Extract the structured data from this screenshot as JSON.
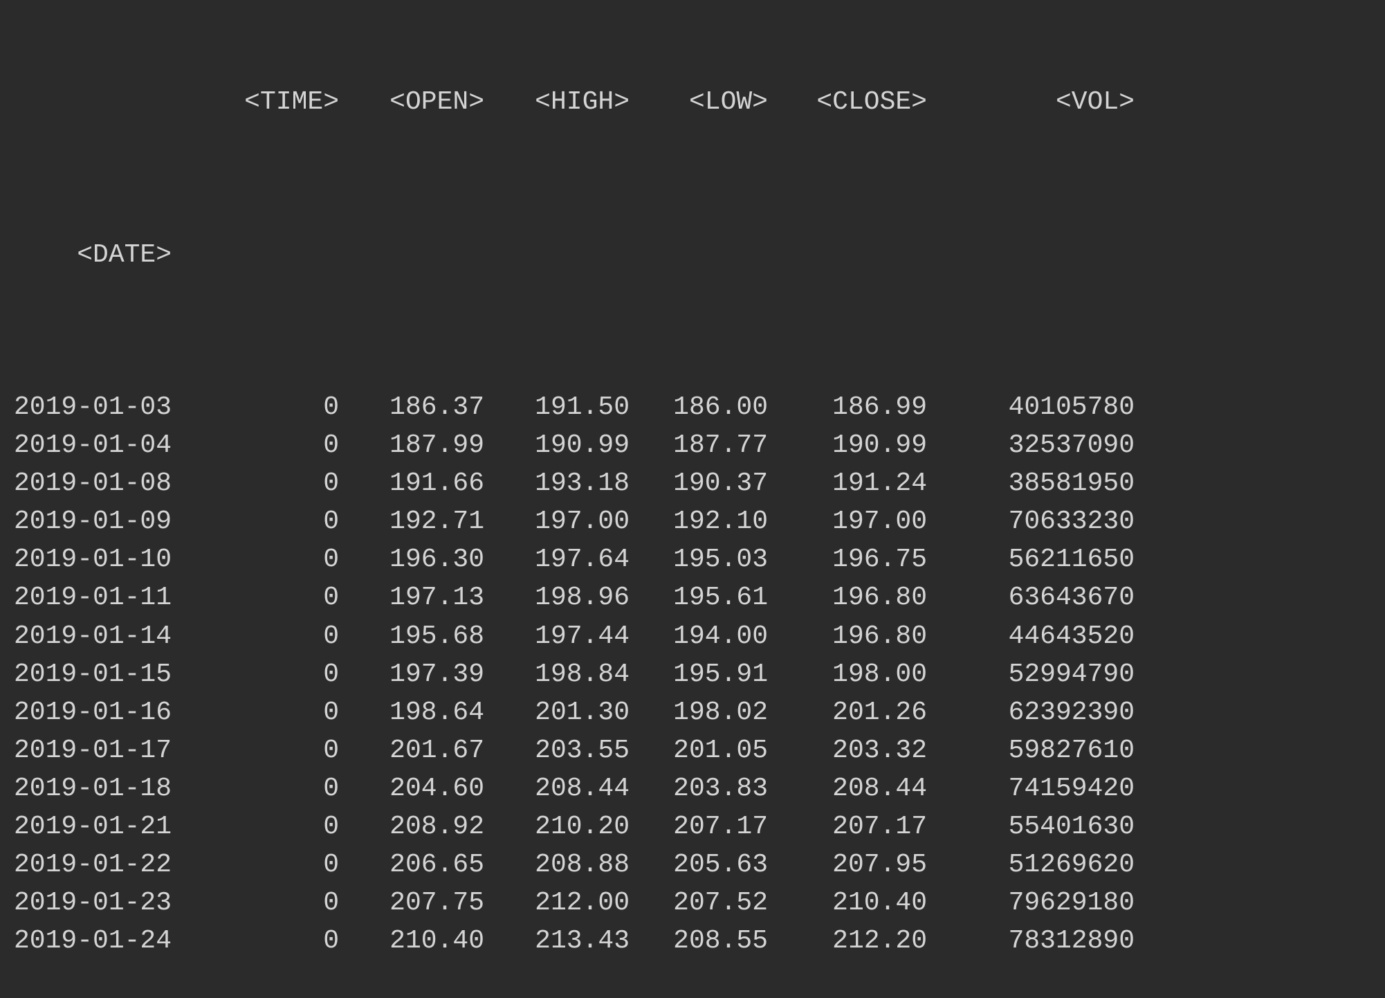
{
  "table": {
    "index_label": "<DATE>",
    "columns": {
      "time": "<TIME>",
      "open": "<OPEN>",
      "high": "<HIGH>",
      "low": "<LOW>",
      "close": "<CLOSE>",
      "vol": "<VOL>"
    },
    "rows": [
      {
        "date": "2019-01-03",
        "time": "0",
        "open": "186.37",
        "high": "191.50",
        "low": "186.00",
        "close": "186.99",
        "vol": "40105780"
      },
      {
        "date": "2019-01-04",
        "time": "0",
        "open": "187.99",
        "high": "190.99",
        "low": "187.77",
        "close": "190.99",
        "vol": "32537090"
      },
      {
        "date": "2019-01-08",
        "time": "0",
        "open": "191.66",
        "high": "193.18",
        "low": "190.37",
        "close": "191.24",
        "vol": "38581950"
      },
      {
        "date": "2019-01-09",
        "time": "0",
        "open": "192.71",
        "high": "197.00",
        "low": "192.10",
        "close": "197.00",
        "vol": "70633230"
      },
      {
        "date": "2019-01-10",
        "time": "0",
        "open": "196.30",
        "high": "197.64",
        "low": "195.03",
        "close": "196.75",
        "vol": "56211650"
      },
      {
        "date": "2019-01-11",
        "time": "0",
        "open": "197.13",
        "high": "198.96",
        "low": "195.61",
        "close": "196.80",
        "vol": "63643670"
      },
      {
        "date": "2019-01-14",
        "time": "0",
        "open": "195.68",
        "high": "197.44",
        "low": "194.00",
        "close": "196.80",
        "vol": "44643520"
      },
      {
        "date": "2019-01-15",
        "time": "0",
        "open": "197.39",
        "high": "198.84",
        "low": "195.91",
        "close": "198.00",
        "vol": "52994790"
      },
      {
        "date": "2019-01-16",
        "time": "0",
        "open": "198.64",
        "high": "201.30",
        "low": "198.02",
        "close": "201.26",
        "vol": "62392390"
      },
      {
        "date": "2019-01-17",
        "time": "0",
        "open": "201.67",
        "high": "203.55",
        "low": "201.05",
        "close": "203.32",
        "vol": "59827610"
      },
      {
        "date": "2019-01-18",
        "time": "0",
        "open": "204.60",
        "high": "208.44",
        "low": "203.83",
        "close": "208.44",
        "vol": "74159420"
      },
      {
        "date": "2019-01-21",
        "time": "0",
        "open": "208.92",
        "high": "210.20",
        "low": "207.17",
        "close": "207.17",
        "vol": "55401630"
      },
      {
        "date": "2019-01-22",
        "time": "0",
        "open": "206.65",
        "high": "208.88",
        "low": "205.63",
        "close": "207.95",
        "vol": "51269620"
      },
      {
        "date": "2019-01-23",
        "time": "0",
        "open": "207.75",
        "high": "212.00",
        "low": "207.52",
        "close": "210.40",
        "vol": "79629180"
      },
      {
        "date": "2019-01-24",
        "time": "0",
        "open": "210.40",
        "high": "213.43",
        "low": "208.55",
        "close": "212.20",
        "vol": "78312890"
      }
    ]
  }
}
